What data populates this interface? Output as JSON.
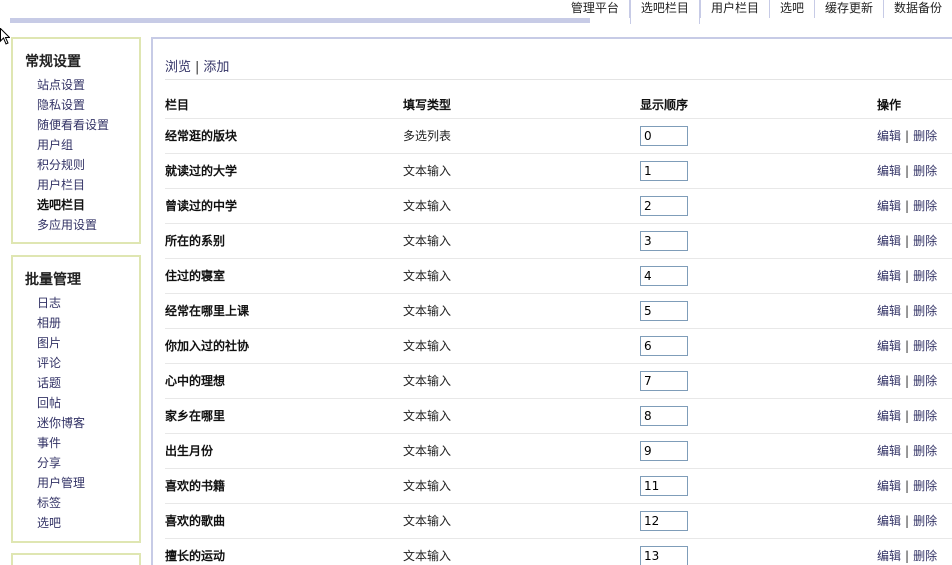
{
  "tabs": [
    {
      "label": "管理平台",
      "active": false
    },
    {
      "label": "选吧栏目",
      "active": true
    },
    {
      "label": "用户栏目",
      "active": false
    },
    {
      "label": "选吧",
      "active": false
    },
    {
      "label": "缓存更新",
      "active": false
    },
    {
      "label": "数据备份",
      "active": false
    }
  ],
  "sidebar": {
    "general": {
      "title": "常规设置",
      "items": [
        "站点设置",
        "隐私设置",
        "随便看看设置",
        "用户组",
        "积分规则",
        "用户栏目",
        "选吧栏目",
        "多应用设置"
      ],
      "current": 6
    },
    "batch": {
      "title": "批量管理",
      "items": [
        "日志",
        "相册",
        "图片",
        "评论",
        "话题",
        "回帖",
        "迷你博客",
        "事件",
        "分享",
        "用户管理",
        "标签",
        "选吧"
      ]
    }
  },
  "subnav": {
    "browse": "浏览",
    "sep": "|",
    "add": "添加"
  },
  "table": {
    "headers": {
      "name": "栏目",
      "type": "填写类型",
      "order": "显示顺序",
      "ops": "操作"
    },
    "op_edit": "编辑",
    "op_sep": "|",
    "op_delete": "删除",
    "rows": [
      {
        "name": "经常逛的版块",
        "type": "多选列表",
        "order": "0"
      },
      {
        "name": "就读过的大学",
        "type": "文本输入",
        "order": "1"
      },
      {
        "name": "曾读过的中学",
        "type": "文本输入",
        "order": "2"
      },
      {
        "name": "所在的系别",
        "type": "文本输入",
        "order": "3"
      },
      {
        "name": "住过的寝室",
        "type": "文本输入",
        "order": "4"
      },
      {
        "name": "经常在哪里上课",
        "type": "文本输入",
        "order": "5"
      },
      {
        "name": "你加入过的社协",
        "type": "文本输入",
        "order": "6"
      },
      {
        "name": "心中的理想",
        "type": "文本输入",
        "order": "7"
      },
      {
        "name": "家乡在哪里",
        "type": "文本输入",
        "order": "8"
      },
      {
        "name": "出生月份",
        "type": "文本输入",
        "order": "9"
      },
      {
        "name": "喜欢的书籍",
        "type": "文本输入",
        "order": "11"
      },
      {
        "name": "喜欢的歌曲",
        "type": "文本输入",
        "order": "12"
      },
      {
        "name": "擅长的运动",
        "type": "文本输入",
        "order": "13"
      }
    ]
  }
}
